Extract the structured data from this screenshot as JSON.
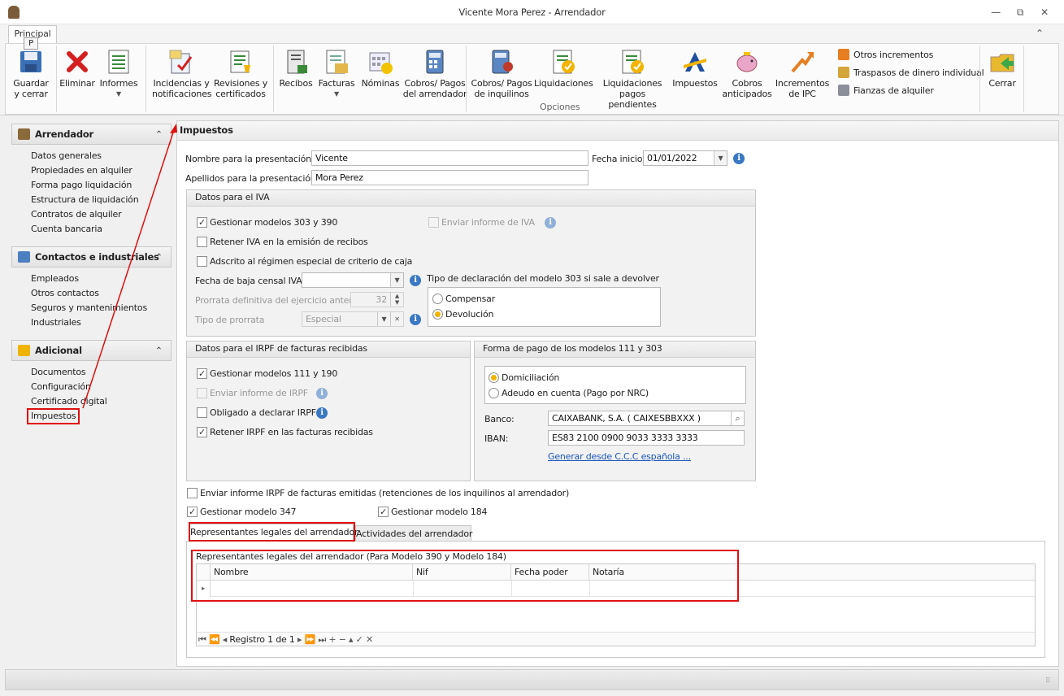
{
  "window": {
    "title": "Vicente Mora Perez - Arrendador",
    "minimize": "—",
    "restore": "⧉",
    "close": "✕"
  },
  "ribbon": {
    "tab": "Principal",
    "tab_key": "P",
    "collapse": "⌃",
    "buttons": {
      "guardar": "Guardar\ny cerrar",
      "eliminar": "Eliminar",
      "informes": "Informes",
      "incidencias": "Incidencias y\nnotificaciones",
      "revisiones": "Revisiones y\ncertificados",
      "recibos": "Recibos",
      "facturas": "Facturas",
      "nominas": "Nóminas",
      "cobros_arr": "Cobros/ Pagos\ndel arrendador",
      "cobros_inq": "Cobros/ Pagos\nde inquilinos",
      "liquidaciones": "Liquidaciones",
      "liq_pend": "Liquidaciones\npagos pendientes",
      "impuestos": "Impuestos",
      "cobros_ant": "Cobros\nanticipados",
      "incr_ipc": "Incrementos\nde IPC",
      "cerrar": "Cerrar"
    },
    "small": {
      "otros": "Otros incrementos",
      "traspasos": "Traspasos de dinero individual",
      "fianzas": "Fianzas de alquiler"
    },
    "group_label": "Opciones",
    "icons": [
      "save-icon",
      "delete-icon",
      "report-icon",
      "incident-icon",
      "certificate-icon",
      "receipt-icon",
      "invoice-icon",
      "payroll-icon",
      "calculator-icon",
      "tenant-payments-icon",
      "settlement-icon",
      "pending-settlement-icon",
      "tax-agency-icon",
      "piggy-bank-icon",
      "ipc-increase-icon",
      "exit-icon"
    ]
  },
  "sidebar": {
    "arrendador": {
      "title": "Arrendador",
      "items": [
        "Datos generales",
        "Propiedades en alquiler",
        "Forma pago liquidación",
        "Estructura de liquidación",
        "Contratos de alquiler",
        "Cuenta bancaria"
      ]
    },
    "contactos": {
      "title": "Contactos e industriales",
      "items": [
        "Empleados",
        "Otros contactos",
        "Seguros y mantenimientos",
        "Industriales"
      ]
    },
    "adicional": {
      "title": "Adicional",
      "items": [
        "Documentos",
        "Configuración",
        "Certificado digital",
        "Impuestos"
      ]
    },
    "chevron": "⌃"
  },
  "main": {
    "title": "Impuestos",
    "nombre_label": "Nombre para la presentación:",
    "nombre_value": "Vicente",
    "apellidos_label": "Apellidos para la presentación:",
    "apellidos_value": "Mora Perez",
    "fecha_inicio_label": "Fecha inicio:",
    "fecha_inicio_value": "01/01/2022",
    "iva": {
      "title": "Datos para el IVA",
      "gestionar": "Gestionar modelos 303 y 390",
      "gestionar_checked": true,
      "enviar_informe": "Enviar informe de IVA",
      "retener": "Retener IVA en la emisión de recibos",
      "adscrito": "Adscrito al régimen especial de criterio de caja",
      "fecha_baja_label": "Fecha de baja censal IVA",
      "fecha_baja_value": "",
      "prorrata_label": "Prorrata definitiva del ejercicio anterior",
      "prorrata_value": "32",
      "tipo_prorrata_label": "Tipo de prorrata",
      "tipo_prorrata_value": "Especial",
      "tipo_decl_label": "Tipo de declaración del modelo 303 si sale a devolver",
      "compensar": "Compensar",
      "devolucion": "Devolución",
      "selected": "Devolución"
    },
    "irpf": {
      "title": "Datos para el IRPF de facturas recibidas",
      "gestionar": "Gestionar modelos 111 y 190",
      "enviar": "Enviar informe de IRPF",
      "obligado": "Obligado a declarar IRPF",
      "retener": "Retener IRPF en las facturas recibidas"
    },
    "pago": {
      "title": "Forma de pago de los modelos 111 y 303",
      "domiciliacion": "Domiciliación",
      "adeudo": "Adeudo en cuenta (Pago por NRC)",
      "selected": "Domiciliación",
      "banco_label": "Banco:",
      "banco_value": "CAIXABANK, S.A. ( CAIXESBBXXX )",
      "iban_label": "IBAN:",
      "iban_value": "ES83 2100 0900 9033 3333 3333",
      "generar_link": "Generar desde C.C.C española ..."
    },
    "enviar_irpf_emitidas": "Enviar informe IRPF de facturas emitidas (retenciones de los inquilinos al arrendador)",
    "gestionar_347": "Gestionar modelo 347",
    "gestionar_184": "Gestionar modelo 184",
    "tabs": [
      "Representantes legales del arrendador",
      "Actividades del arrendador"
    ],
    "grid": {
      "title": "Representantes legales del arrendador (Para Modelo 390 y Modelo 184)",
      "columns": [
        "Nombre",
        "Nif",
        "Fecha poder",
        "Notaría"
      ],
      "nav_record": "Registro 1 de 1",
      "nav_first": "⏮",
      "nav_prev_page": "⏪",
      "nav_prev": "◂",
      "nav_next": "▸",
      "nav_next_page": "⏩",
      "nav_last": "⏭",
      "nav_add": "+",
      "nav_remove": "−",
      "nav_up": "▴",
      "nav_ok": "✓",
      "nav_cancel": "✕",
      "row_indicator": "▸"
    },
    "check_mark": "✓"
  },
  "colors": {
    "accent": "#3a78c2",
    "highlight": "#e01010",
    "radio_on": "#f0b400",
    "link": "#1a55b8"
  }
}
